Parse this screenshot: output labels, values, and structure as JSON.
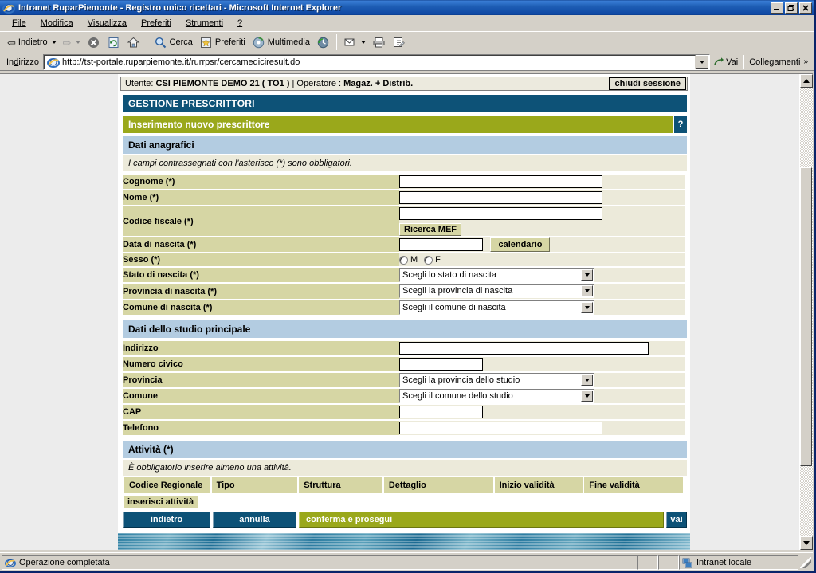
{
  "window": {
    "title": "Intranet RuparPiemonte - Registro unico ricettari - Microsoft Internet Explorer",
    "minimize": "_",
    "maximize": "❐",
    "close": "✕"
  },
  "menu": {
    "items": [
      "File",
      "Modifica",
      "Visualizza",
      "Preferiti",
      "Strumenti",
      "?"
    ]
  },
  "toolbar": {
    "back": "Indietro",
    "forward": "",
    "stop_icon": "stop-icon",
    "refresh_icon": "refresh-icon",
    "home_icon": "home-icon",
    "search": "Cerca",
    "favorites": "Preferiti",
    "media": "Multimedia",
    "history_icon": "history-icon",
    "mail_icon": "mail-icon",
    "print_icon": "print-icon",
    "edit_icon": "edit-icon"
  },
  "address": {
    "label": "Indirizzo",
    "url": "http://tst-portale.ruparpiemonte.it/rurrpsr/cercamediciresult.do",
    "go": "Vai",
    "links": "Collegamenti",
    "links_chevron": "»"
  },
  "session": {
    "user_label": "Utente:",
    "user_name": "CSI PIEMONTE DEMO 21 ( TO1 )",
    "separator": "|",
    "operator_label": "Operatore :",
    "operator_name": "Magaz. + Distrib.",
    "close_session": "chiudi sessione"
  },
  "page": {
    "section_title": "GESTIONE PRESCRITTORI",
    "subsection_title": "Inserimento nuovo prescrittore",
    "help_label": "?",
    "anagrafici_header": "Dati anagrafici",
    "anagrafici_note": "I campi contrassegnati con l'asterisco (*) sono obbligatori.",
    "studio_header": "Dati dello studio principale",
    "attivita_header": "Attività (*)",
    "attivita_note": "È obbligatorio inserire almeno una attività."
  },
  "fields_anagrafici": [
    {
      "label": "Cognome (*)",
      "type": "text",
      "value": "",
      "width": "w255"
    },
    {
      "label": "Nome (*)",
      "type": "text",
      "value": "",
      "width": "w255"
    },
    {
      "label": "Codice fiscale (*)",
      "type": "text-button",
      "value": "",
      "width": "w255",
      "button": "Ricerca MEF"
    },
    {
      "label": "Data di nascita (*)",
      "type": "text-button",
      "value": "",
      "width": "w105",
      "button": "calendario"
    },
    {
      "label": "Sesso (*)",
      "type": "radio",
      "options": [
        "M",
        "F"
      ]
    },
    {
      "label": "Stato di nascita (*)",
      "type": "select",
      "value": "Scegli lo stato di nascita"
    },
    {
      "label": "Provincia di nascita (*)",
      "type": "select",
      "value": "Scegli la provincia di nascita"
    },
    {
      "label": "Comune di nascita (*)",
      "type": "select",
      "value": "Scegli il comune di nascita"
    }
  ],
  "fields_studio": [
    {
      "label": "Indirizzo",
      "type": "text",
      "value": "",
      "width": "w313"
    },
    {
      "label": "Numero civico",
      "type": "text",
      "value": "",
      "width": "w105"
    },
    {
      "label": "Provincia",
      "type": "select",
      "value": "Scegli la provincia dello studio"
    },
    {
      "label": "Comune",
      "type": "select",
      "value": "Scegli il comune dello studio"
    },
    {
      "label": "CAP",
      "type": "text",
      "value": "",
      "width": "w105"
    },
    {
      "label": "Telefono",
      "type": "text",
      "value": "",
      "width": "w255"
    }
  ],
  "attivita_table": {
    "columns": [
      "Codice Regionale",
      "Tipo",
      "Struttura",
      "Dettaglio",
      "Inizio validità",
      "Fine validità"
    ],
    "rows": [],
    "insert_button": "inserisci attività"
  },
  "actions": {
    "back": "indietro",
    "cancel": "annulla",
    "confirm": "conferma e prosegui",
    "go": "vai"
  },
  "status": {
    "message": "Operazione completata",
    "zone": "Intranet locale"
  },
  "colors": {
    "navy": "#0d5277",
    "olive": "#9aa81b",
    "light_blue": "#b3cce1",
    "label_bg": "#d6d6a4",
    "value_bg": "#eceada",
    "title_blue": "#1049a5"
  }
}
